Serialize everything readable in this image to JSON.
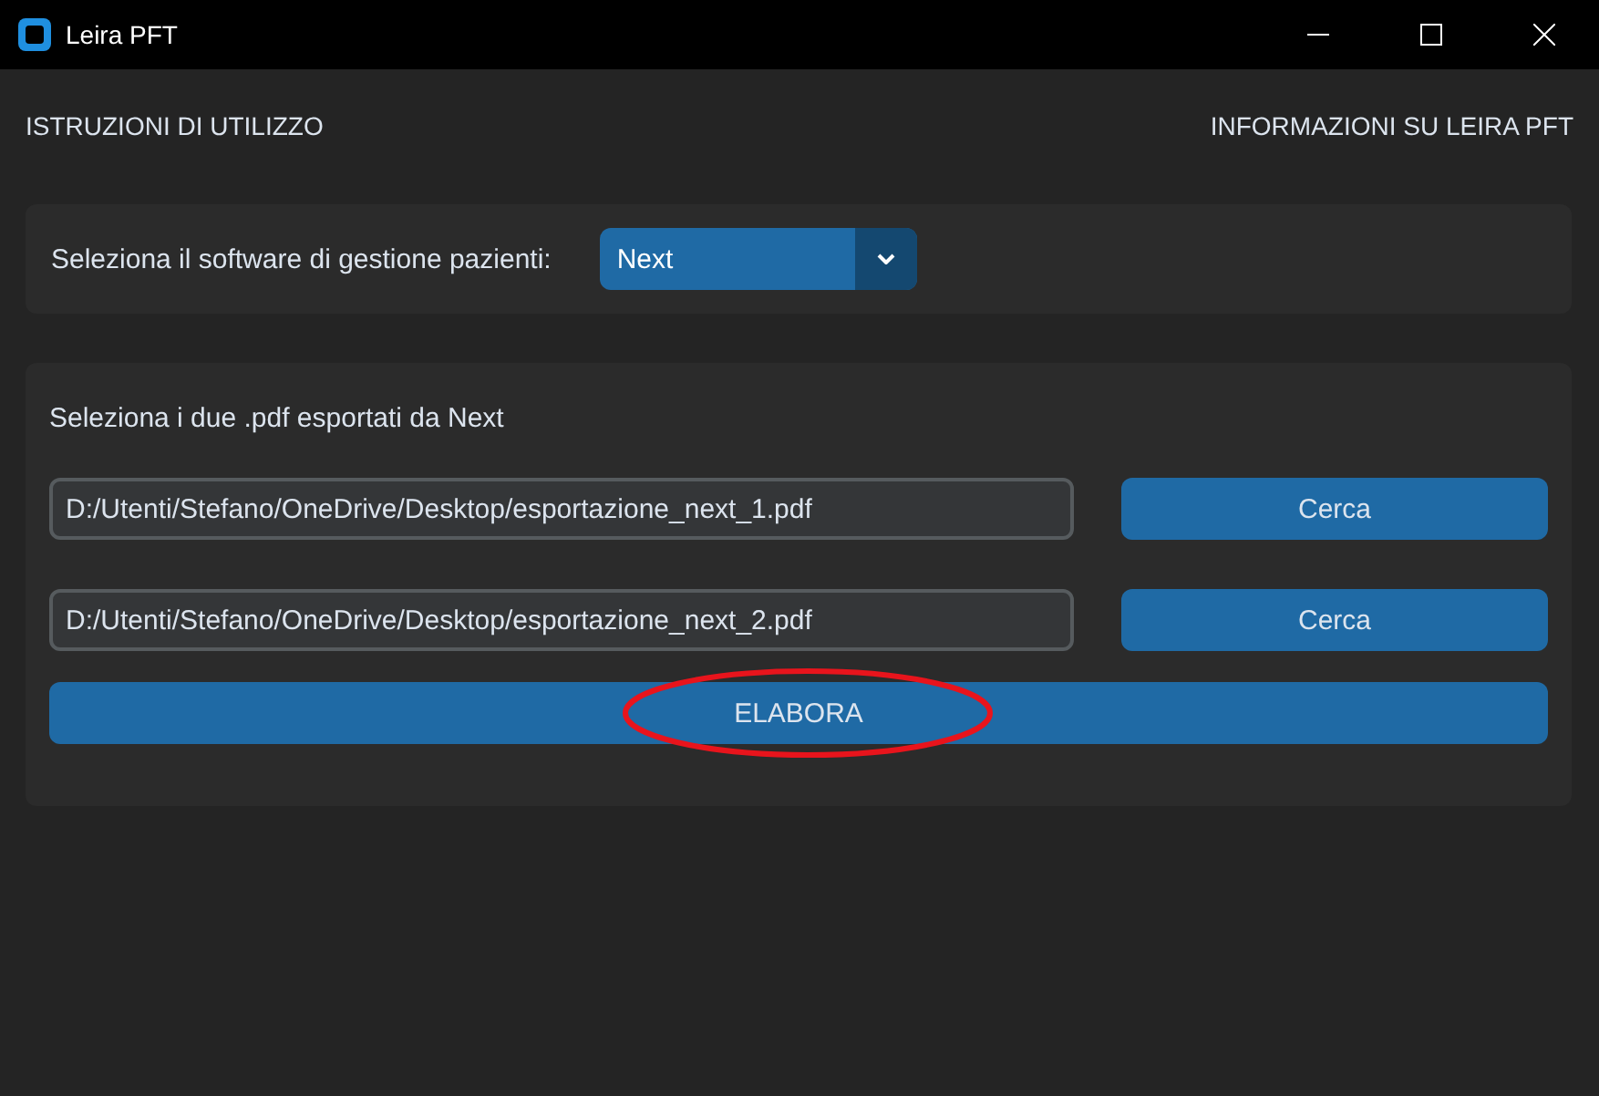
{
  "window": {
    "title": "Leira PFT"
  },
  "menu": [
    {
      "label": "ISTRUZIONI DI UTILIZZO"
    },
    {
      "label": "INFORMAZIONI SU LEIRA PFT"
    }
  ],
  "software": {
    "label": "Seleziona il software di gestione pazienti:",
    "value": "Next"
  },
  "files": {
    "label": "Seleziona i due .pdf esportati da Next",
    "rows": [
      {
        "value": "D:/Utenti/Stefano/OneDrive/Desktop/esportazione_next_1.pdf",
        "button": "Cerca"
      },
      {
        "value": "D:/Utenti/Stefano/OneDrive/Desktop/esportazione_next_2.pdf",
        "button": "Cerca"
      }
    ],
    "action": {
      "label": "ELABORA",
      "highlighted": true
    }
  }
}
